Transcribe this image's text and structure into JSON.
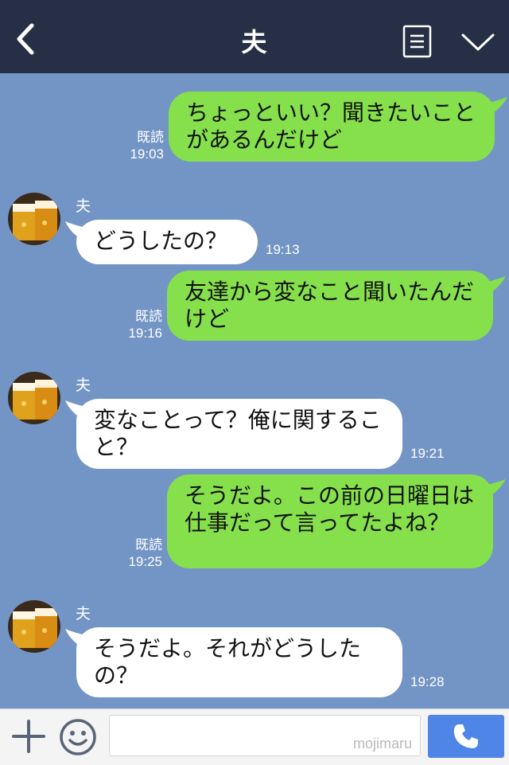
{
  "header": {
    "title": "夫"
  },
  "messages": [
    {
      "dir": "out",
      "text": "ちょっといい？聞きたいことがあるんだけど",
      "read": "既読",
      "time": "19:03"
    },
    {
      "dir": "in",
      "sender": "夫",
      "text": "どうしたの？",
      "time": "19:13"
    },
    {
      "dir": "out",
      "text": "友達から変なこと聞いたんだけど",
      "read": "既読",
      "time": "19:16"
    },
    {
      "dir": "in",
      "sender": "夫",
      "text": "変なことって？俺に関すること？",
      "time": "19:21"
    },
    {
      "dir": "out",
      "text": "そうだよ。この前の日曜日は仕事だって言ってたよね？",
      "read": "既読",
      "time": "19:25"
    },
    {
      "dir": "in",
      "sender": "夫",
      "text": "そうだよ。それがどうしたの？",
      "time": "19:28"
    }
  ],
  "input": {
    "placeholder": "",
    "watermark": "mojimaru"
  },
  "icons": {
    "back": "chevron-left-icon",
    "menu": "document-menu-icon",
    "collapse": "chevron-down-icon",
    "add": "plus-icon",
    "emoji": "smiley-icon",
    "call": "phone-icon"
  },
  "colors": {
    "header_bg": "#262f45",
    "chat_bg": "#7395c5",
    "outgoing_bubble": "#86e04c",
    "incoming_bubble": "#ffffff",
    "call_button": "#4e85e6"
  }
}
